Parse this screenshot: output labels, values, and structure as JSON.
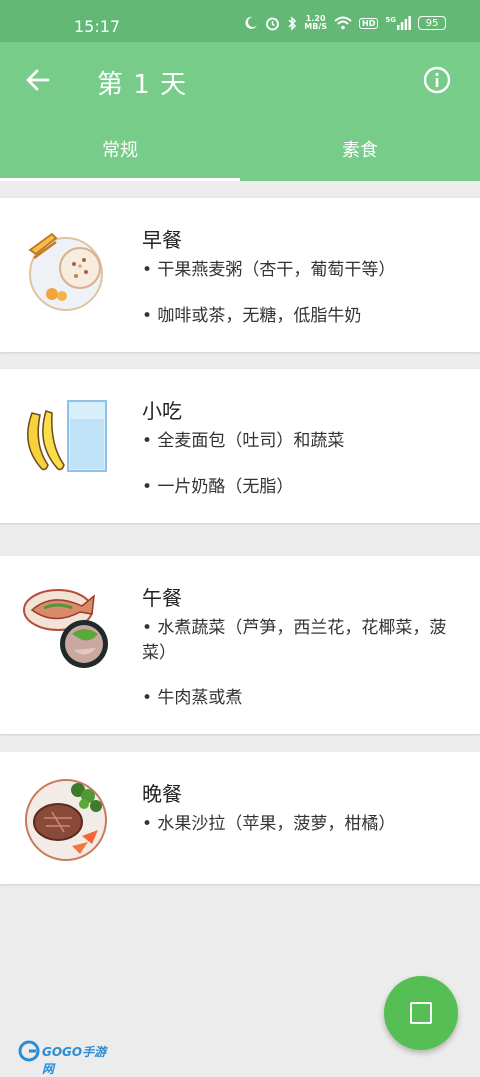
{
  "status_bar": {
    "time": "15:17",
    "net_speed_value": "1.20",
    "net_speed_unit": "MB/S",
    "hd_label": "HD",
    "signal_label": "5G",
    "battery": "95"
  },
  "header": {
    "title": "第 1 天",
    "back_icon": "arrow-left-icon",
    "info_icon": "info-circle-icon"
  },
  "tabs": [
    {
      "label": "常规",
      "active": true
    },
    {
      "label": "素食",
      "active": false
    }
  ],
  "meals": [
    {
      "title": "早餐",
      "image": "breakfast-image",
      "items": [
        "• 干果燕麦粥（杏干，葡萄干等）",
        "• 咖啡或茶，无糖，低脂牛奶"
      ]
    },
    {
      "title": "小吃",
      "image": "snack-image",
      "items": [
        "• 全麦面包（吐司）和蔬菜",
        "• 一片奶酪（无脂）"
      ]
    },
    {
      "title": "午餐",
      "image": "lunch-image",
      "items": [
        "• 水煮蔬菜（芦笋，西兰花，花椰菜，菠菜）",
        "• 牛肉蒸或煮"
      ]
    },
    {
      "title": "晚餐",
      "image": "dinner-image",
      "items": [
        "• 水果沙拉（苹果，菠萝，柑橘）"
      ]
    }
  ],
  "fab": {
    "icon": "square-icon"
  },
  "watermark": {
    "text": "GOGO手游网"
  },
  "colors": {
    "status_bar": "#63b876",
    "app_bar": "#77cc89",
    "fab": "#55bf55",
    "background": "#ececec"
  }
}
